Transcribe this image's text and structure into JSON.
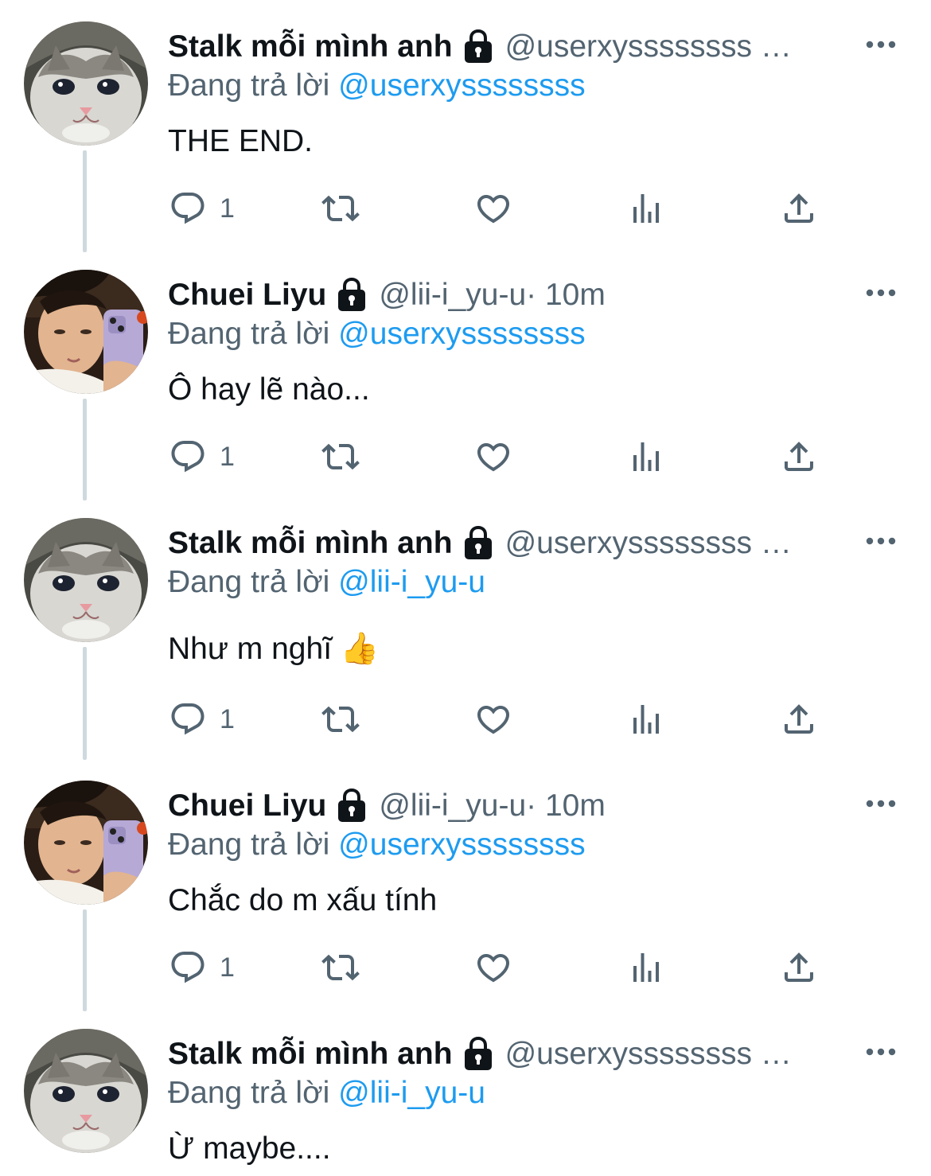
{
  "colors": {
    "text": "#0f1419",
    "secondary": "#536471",
    "link": "#1d9bf0",
    "thread_line": "#cfd9de"
  },
  "labels": {
    "replying_to": "Đang trả lời"
  },
  "tweets": [
    {
      "name": "Stalk mỗi mình anh",
      "handle": "@userxyssssssss …",
      "time": "",
      "reply_to": "@userxyssssssss",
      "text": "THE END.",
      "reply_count": "1",
      "avatar": "cat"
    },
    {
      "name": "Chuei Liyu",
      "handle": "@lii-i_yu-u",
      "time": " · 10m",
      "reply_to": "@userxyssssssss",
      "text": "Ô hay lẽ nào...",
      "reply_count": "1",
      "avatar": "boy"
    },
    {
      "name": "Stalk mỗi mình anh",
      "handle": "@userxyssssssss …",
      "time": "",
      "reply_to": "@lii-i_yu-u",
      "text": "Như m nghĩ 👍",
      "reply_count": "1",
      "avatar": "cat"
    },
    {
      "name": "Chuei Liyu",
      "handle": "@lii-i_yu-u",
      "time": " · 10m",
      "reply_to": "@userxyssssssss",
      "text": "Chắc do m xấu tính",
      "reply_count": "1",
      "avatar": "boy"
    },
    {
      "name": "Stalk mỗi mình anh",
      "handle": "@userxyssssssss …",
      "time": "",
      "reply_to": "@lii-i_yu-u",
      "text": "Ừ maybe....",
      "reply_count": "",
      "avatar": "cat"
    }
  ]
}
